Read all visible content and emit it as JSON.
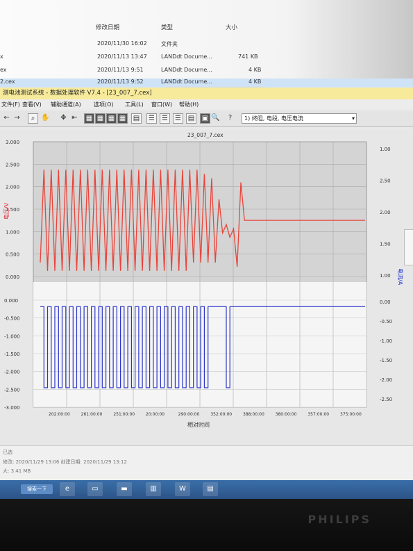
{
  "explorer": {
    "headers": {
      "date": "修改日期",
      "type": "类型",
      "size": "大小"
    },
    "rows": [
      {
        "name": "",
        "date": "2020/11/30 16:02",
        "type": "文件夹",
        "size": ""
      },
      {
        "name": "x",
        "date": "2020/11/13 13:47",
        "type": "LANDdt Docume...",
        "size": "741 KB"
      },
      {
        "name": "ex",
        "date": "2020/11/13 9:51",
        "type": "LANDdt Docume...",
        "size": "4 KB"
      },
      {
        "name": "2.cex",
        "date": "2020/11/13 9:52",
        "type": "LANDdt Docume...",
        "size": "4 KB"
      }
    ]
  },
  "app": {
    "title": "测电池测试系统 - 数据处理软件 V7.4 - [23_007_7.cex]",
    "menus": [
      "文件(F)",
      "查看(V)",
      "辅助通道(A)",
      "选项(O)",
      "工具(L)",
      "窗口(W)",
      "帮助(H)"
    ],
    "toolbar_field": "1) 终阻, 电段, 电压电流",
    "status_lines": [
      "已选",
      "修改: 2020/11/29 13:06   创建日期: 2020/11/29 13:12",
      "大: 3.41 MB"
    ]
  },
  "taskbar": {
    "start_label": "搜索一下"
  },
  "brand": "PHILIPS",
  "chart_data": [
    {
      "type": "line",
      "title": "23_007_7.cex",
      "ylabel": "电压/V",
      "y2label": "电流/A",
      "ylim": [
        0.0,
        3.0
      ],
      "y_ticks": [
        "3.000",
        "2.500",
        "2.000",
        "1.500",
        "1.000",
        "0.500",
        "0.000"
      ],
      "y2_ticks": [
        "1.00",
        "2.50",
        "2.00",
        "1.50",
        "1.00"
      ],
      "color": "#e8443a",
      "series": [
        {
          "description": "voltage oscillating 0.1-2.5 V over ~24 cycles, then damped drop and steady around 2.0 V",
          "values": [
            0.3,
            2.5,
            0.1,
            2.5,
            0.1,
            2.5,
            0.1,
            2.5,
            0.1,
            2.5,
            0.1,
            2.5,
            0.1,
            2.5,
            0.1,
            2.5,
            0.1,
            2.5,
            0.1,
            2.5,
            0.1,
            2.5,
            0.1,
            2.5,
            0.1,
            2.5,
            0.1,
            2.5,
            0.1,
            2.5,
            0.1,
            2.5,
            0.1,
            2.5,
            0.1,
            2.5,
            0.1,
            2.5,
            0.1,
            2.5,
            0.1,
            2.5,
            0.3,
            2.5,
            0.3,
            2.4,
            0.3,
            2.3,
            0.3,
            1.8,
            1.0,
            1.2,
            0.9,
            1.1,
            0.2,
            2.2,
            1.3,
            1.3,
            1.3,
            1.3
          ]
        }
      ]
    },
    {
      "type": "line",
      "xlabel": "相对时间",
      "ylim": [
        -3.0,
        0.0
      ],
      "y_ticks": [
        "0.000",
        "-0.500",
        "-1.000",
        "-1.500",
        "-2.000",
        "-2.500",
        "-3.000"
      ],
      "y2_ticks": [
        "0.00",
        "-0.50",
        "-1.00",
        "-1.50",
        "-2.00",
        "-2.50"
      ],
      "x_ticks": [
        "202:00:00",
        "261:00:00",
        "251:00:00",
        "20:00:00",
        "290:00:00",
        "352:00:00",
        "388:00:00",
        "380:00:00",
        "357:00:00",
        "375:00:00"
      ],
      "color": "#2b35c9",
      "series": [
        {
          "description": "current square wave between -0.2 and -2.7 A, pulses then steady -0.2",
          "values": [
            -0.2,
            -2.7,
            -0.2,
            -2.7,
            -0.2,
            -2.7,
            -0.2,
            -2.7,
            -0.2,
            -2.7,
            -0.2,
            -2.7,
            -0.2,
            -2.7,
            -0.2,
            -2.7,
            -0.2,
            -2.7,
            -0.2,
            -2.7,
            -0.2,
            -2.7,
            -0.2,
            -2.7,
            -0.2,
            -2.7,
            -0.2,
            -2.7,
            -0.2,
            -2.7,
            -0.2,
            -2.7,
            -0.2,
            -2.7,
            -0.2,
            -2.7,
            -0.2,
            -2.7,
            -0.2,
            -2.7,
            -0.2,
            -2.7,
            -0.2,
            -2.7,
            -0.2,
            -2.7,
            -0.2,
            -0.2,
            -0.2,
            -0.2,
            -0.2,
            -2.7,
            -0.2,
            -0.2,
            -0.2,
            -0.2,
            -0.2,
            -0.2,
            -0.2,
            -0.2
          ]
        }
      ]
    }
  ]
}
